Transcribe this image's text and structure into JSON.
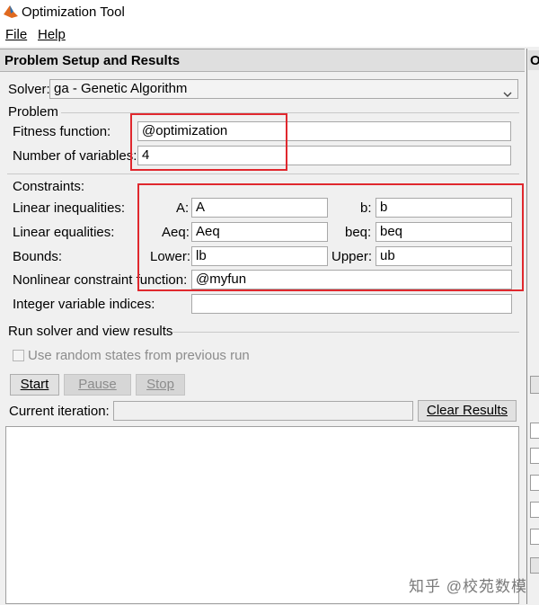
{
  "window": {
    "title": "Optimization Tool",
    "icon": "matlab-icon"
  },
  "menu": [
    {
      "label": "File"
    },
    {
      "label": "Help"
    }
  ],
  "panel": {
    "title": "Problem Setup and Results"
  },
  "solver": {
    "label": "Solver:",
    "value": "ga - Genetic Algorithm"
  },
  "problem": {
    "heading": "Problem",
    "fitness_label": "Fitness function:",
    "fitness_value": "@optimization",
    "nvars_label": "Number of variables:",
    "nvars_value": "4"
  },
  "constraints": {
    "heading": "Constraints:",
    "linear_ineq": {
      "label": "Linear inequalities:",
      "a_label": "A:",
      "a_value": "A",
      "b_label": "b:",
      "b_value": "b"
    },
    "linear_eq": {
      "label": "Linear equalities:",
      "aeq_label": "Aeq:",
      "aeq_value": "Aeq",
      "beq_label": "beq:",
      "beq_value": "beq"
    },
    "bounds": {
      "label": "Bounds:",
      "lower_label": "Lower:",
      "lower_value": "lb",
      "upper_label": "Upper:",
      "upper_value": "ub"
    },
    "nonlcon": {
      "label": "Nonlinear constraint function:",
      "value": "@myfun"
    },
    "intcon": {
      "label": "Integer variable indices:",
      "value": ""
    }
  },
  "run": {
    "heading": "Run solver and view results",
    "random_states_label": "Use random states from previous run",
    "start_label": "Start",
    "pause_label": "Pause",
    "stop_label": "Stop",
    "iteration_label": "Current iteration:",
    "iteration_value": "",
    "clear_label": "Clear Results"
  },
  "right_panel": {
    "header_fragment": "O"
  },
  "watermark": "知乎 @校苑数模",
  "colors": {
    "highlight_box": "#e0282e",
    "panel_header": "#dfdfdf"
  }
}
